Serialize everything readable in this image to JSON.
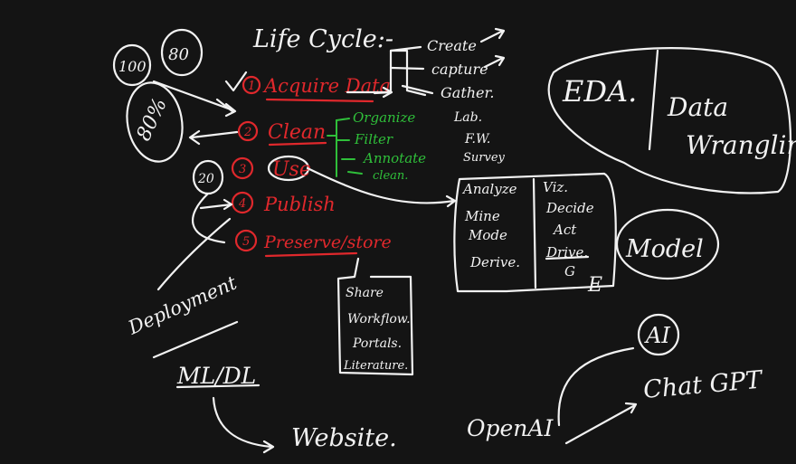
{
  "title": "Life Cycle:-",
  "badges": {
    "b100": "100",
    "b80": "80",
    "b80pct": "80%",
    "b20": "20"
  },
  "steps": [
    {
      "num": "1",
      "label": "Acquire Data"
    },
    {
      "num": "2",
      "label": "Clean"
    },
    {
      "num": "3",
      "label": "Use"
    },
    {
      "num": "4",
      "label": "Publish"
    },
    {
      "num": "5",
      "label": "Preserve/store"
    }
  ],
  "acquire_branches": [
    "Create",
    "capture",
    "Gather."
  ],
  "gather_sources": [
    "Lab.",
    "F.W.",
    "Survey"
  ],
  "clean_branches": [
    "Organize",
    "Filter",
    "Annotate",
    "clean."
  ],
  "use_box": {
    "left": [
      "Analyze",
      "Mine",
      "Mode",
      "Derive."
    ],
    "right": [
      "Viz.",
      "Decide",
      "Act",
      "Drive."
    ],
    "marks": [
      "G",
      "E"
    ]
  },
  "model_label": "Model",
  "eda_label": "EDA.",
  "wrangling_label": [
    "Data",
    "Wrangling"
  ],
  "preserve_box": [
    "Share",
    "Workflow.",
    "Portals.",
    "Literature."
  ],
  "deployment_label": "Deployment",
  "mldl_label": "ML/DL",
  "website_label": "Website.",
  "openai_label": "OpenAI",
  "ai_label": "AI",
  "chatgpt_label": "Chat GPT"
}
